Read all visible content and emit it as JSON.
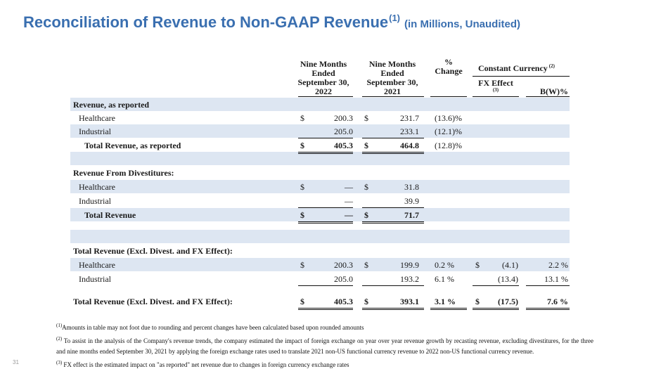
{
  "title": {
    "main": "Reconciliation of Revenue to Non-GAAP Revenue",
    "marker": "(1)",
    "sub": "(in Millions, Unaudited)"
  },
  "headers": {
    "col1": [
      "Nine Months",
      "Ended",
      "September 30,",
      "2022"
    ],
    "col2": [
      "Nine Months",
      "Ended",
      "September 30,",
      "2021"
    ],
    "col3": [
      "%",
      "Change"
    ],
    "cc": "Constant Currency",
    "cc_note": "(2)",
    "fx": "FX Effect",
    "fx_note": "(3)",
    "bw": "B(W)%"
  },
  "rows": {
    "r1": {
      "label": "Revenue, as reported"
    },
    "r2": {
      "label": "Healthcare",
      "d1": "$",
      "v1": "200.3",
      "d2": "$",
      "v2": "231.7",
      "pct": "(13.6)%"
    },
    "r3": {
      "label": "Industrial",
      "v1": "205.0",
      "v2": "233.1",
      "pct": "(12.1)%"
    },
    "r4": {
      "label": "Total Revenue, as reported",
      "d1": "$",
      "v1": "405.3",
      "d2": "$",
      "v2": "464.8",
      "pct": "(12.8)%"
    },
    "r5": {
      "label": "Revenue From Divestitures:"
    },
    "r6": {
      "label": "Healthcare",
      "d1": "$",
      "v1": "—",
      "d2": "$",
      "v2": "31.8"
    },
    "r7": {
      "label": "Industrial",
      "v1": "—",
      "v2": "39.9"
    },
    "r8": {
      "label": "Total Revenue",
      "d1": "$",
      "v1": "—",
      "d2": "$",
      "v2": "71.7"
    },
    "r9": {
      "label": "Total Revenue (Excl.  Divest. and FX Effect):"
    },
    "r10": {
      "label": "Healthcare",
      "d1": "$",
      "v1": "200.3",
      "d2": "$",
      "v2": "199.9",
      "pct": "0.2 %",
      "d3": "$",
      "v3": "(4.1)",
      "bw": "2.2 %"
    },
    "r11": {
      "label": "Industrial",
      "v1": "205.0",
      "v2": "193.2",
      "pct": "6.1 %",
      "v3": "(13.4)",
      "bw": "13.1 %"
    },
    "r12": {
      "label": "Total Revenue (Excl.  Divest. and FX Effect):",
      "d1": "$",
      "v1": "405.3",
      "d2": "$",
      "v2": "393.1",
      "pct": "3.1 %",
      "d3": "$",
      "v3": "(17.5)",
      "bw": "7.6 %"
    }
  },
  "footnotes": {
    "f1_mark": "(1)",
    "f1": "Amounts in table may not foot due to rounding and percent changes have been calculated based upon rounded amounts",
    "f2_mark": "(2)",
    "f2": " To assist in the analysis of the Company's revenue trends, the company estimated the impact of foreign exchange on year over year revenue growth by recasting revenue, excluding divestitures, for the three and nine months ended September 30, 2021 by applying the foreign exchange rates used to translate 2021 non-US functional currency revenue to 2022 non-US functional currency revenue.",
    "f3_mark": "(3)",
    "f3": " FX effect is the estimated impact on \"as reported\" net revenue due to changes in foreign currency exchange rates"
  },
  "page_number": "31"
}
